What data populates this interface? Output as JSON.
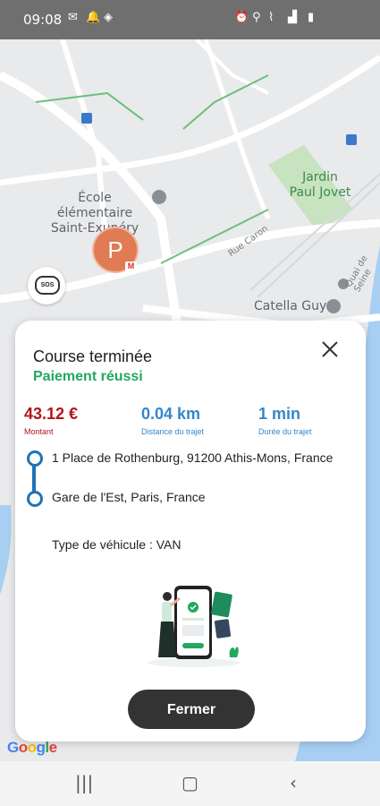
{
  "status_bar": {
    "time": "09:08",
    "left_icons": [
      "gmail-icon",
      "notification-bell-icon",
      "dot-icon"
    ],
    "right_icons": [
      "alarm-icon",
      "location-icon",
      "wifi-calling-icon",
      "signal-icon",
      "battery-icon"
    ]
  },
  "map": {
    "labels": {
      "school": "École élémentaire\nSaint-Exupéry",
      "park": "Jardin\nPaul Jovet",
      "catella": "Catella Guy",
      "rue_caron": "Rue Caron",
      "quai": "Quai de Seine"
    },
    "marker_letter": "P",
    "sos_label": "SOS",
    "google_logo": "Google",
    "colors": {
      "road": "#ffffff",
      "park": "#c7e3c0",
      "water": "#a8cff2",
      "accent_path": "#6cbf7a"
    }
  },
  "card": {
    "title": "Course terminée",
    "subtitle": "Paiement réussi",
    "stats": [
      {
        "value": "43.12 €",
        "label": "Montant"
      },
      {
        "value": "0.04 km",
        "label": "Distance du trajet"
      },
      {
        "value": "1 min",
        "label": "Durée du trajet"
      }
    ],
    "pickup_address": "1 Place de Rothenburg, 91200 Athis-Mons, France",
    "dropoff_address": "Gare de l'Est, Paris, France",
    "vehicle_type": "Type de véhicule : VAN",
    "close_button_label": "Fermer",
    "colors": {
      "amount": "#b3141d",
      "info_blue": "#3487c9",
      "success": "#22a85f",
      "route": "#1e73b8"
    }
  },
  "nav_bar": {
    "icons": [
      "recent-apps-icon",
      "home-icon",
      "back-icon"
    ]
  }
}
